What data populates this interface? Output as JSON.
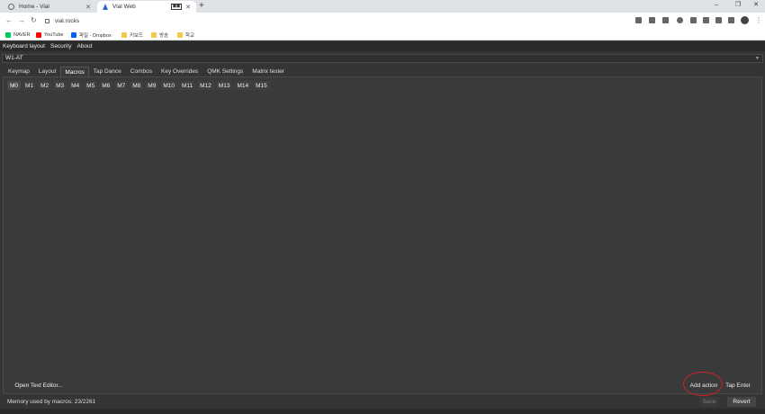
{
  "browser": {
    "tabs": [
      {
        "title": "Home - Vial",
        "active": false
      },
      {
        "title": "Vial Web",
        "active": true
      }
    ],
    "new_tab": "+",
    "url": "vial.rocks",
    "window_controls": [
      "–",
      "❐",
      "✕"
    ],
    "nav": {
      "back": "←",
      "forward": "→",
      "reload": "↻"
    },
    "bookmarks": [
      {
        "label": "NAVER",
        "color": "#03c75a"
      },
      {
        "label": "YouTube",
        "color": "#ff0000"
      },
      {
        "label": "파일 - Dropbox",
        "color": "#0061ff"
      },
      {
        "label": "키보드",
        "color": "#f1c94b"
      },
      {
        "label": "방송",
        "color": "#f1c94b"
      },
      {
        "label": "학교",
        "color": "#f1c94b"
      }
    ]
  },
  "app": {
    "menu": [
      "Keyboard layout",
      "Security",
      "About"
    ],
    "keyboard_selector": "W1-AT",
    "tabs": [
      "Keymap",
      "Layout",
      "Macros",
      "Tap Dance",
      "Combos",
      "Key Overrides",
      "QMK Settings",
      "Matrix tester"
    ],
    "active_tab": "Macros",
    "macro_tabs": [
      "M0",
      "M1",
      "M2",
      "M3",
      "M4",
      "M5",
      "M6",
      "M7",
      "M8",
      "M9",
      "M10",
      "M11",
      "M12",
      "M13",
      "M14",
      "M15"
    ],
    "active_macro": "M0",
    "buttons": {
      "open_text_editor": "Open Text Editor...",
      "add_action": "Add action",
      "tap_enter": "Tap Enter",
      "save": "Save",
      "revert": "Revert"
    },
    "memory_status": "Memory used by macros: 23/2261",
    "annotation_color": "#d2202a"
  }
}
